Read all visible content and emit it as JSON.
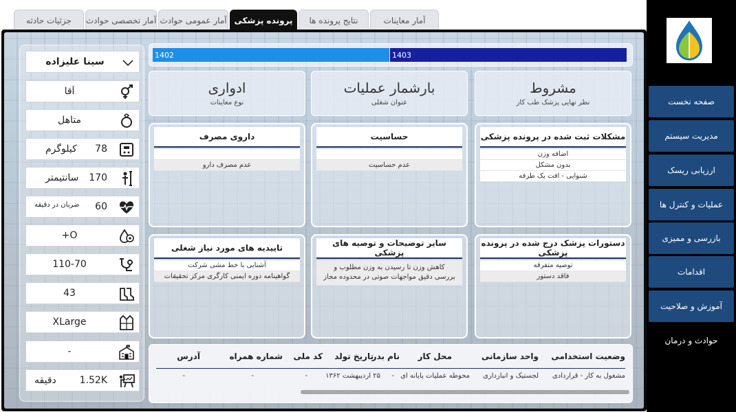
{
  "tabs": [
    {
      "label": "جزئیات حادثه",
      "active": false
    },
    {
      "label": "آمار تخصصی حوادث",
      "active": false
    },
    {
      "label": "آمار عمومی حوادث",
      "active": false
    },
    {
      "label": "پرونده پزشکی",
      "active": true
    },
    {
      "label": "نتایج پرونده ها",
      "active": false
    },
    {
      "label": "آمار معاینات",
      "active": false
    }
  ],
  "sidebar": {
    "logo_icon": "drop-leaf-logo-icon",
    "items": [
      {
        "label": "صفحه نخست"
      },
      {
        "label": "مدیریت سیستم"
      },
      {
        "label": "ارزیابی ریسک"
      },
      {
        "label": "عملیات و کنترل ها"
      },
      {
        "label": "بازرسی و ممیزی"
      },
      {
        "label": "اقدامات"
      },
      {
        "label": "آموزش و صلاحیت"
      },
      {
        "label": "حوادث و درمان"
      }
    ]
  },
  "profile": {
    "name": "سینا علیزاده",
    "gender": "آقا",
    "marital": "متاهل",
    "weight": {
      "value": "78",
      "unit": "کیلوگرم"
    },
    "height": {
      "value": "170",
      "unit": "سانتیمتر"
    },
    "heart_rate": {
      "value": "60",
      "unit": "ضربان در دقیقه"
    },
    "blood_type": "O+",
    "blood_pressure": "110-70",
    "shoe_size": "43",
    "clothing_size": "XLarge",
    "education": "-",
    "presentation": {
      "value": "1.52K",
      "unit": "دقیقه"
    }
  },
  "year_bar": {
    "segments": [
      {
        "label": "1402",
        "share": 0.495,
        "color": "#1e8fe8"
      },
      {
        "label": "1403",
        "share": 0.505,
        "color": "#16209e"
      }
    ]
  },
  "kpis": [
    {
      "value": "مشروط",
      "label": "نظر نهایی پزشک طب کار"
    },
    {
      "value": "بارشمار عملیات",
      "label": "عنوان شغلی"
    },
    {
      "value": "ادواری",
      "label": "نوع معاینات"
    }
  ],
  "cards": {
    "problems": {
      "title": "مشکلات ثبت شده در پرونده پزشکی",
      "rows": [
        "اضافه وزن",
        "بدون مشکل",
        "شنوایی - افت یک طرفه"
      ]
    },
    "sensitivity": {
      "title": "حساسیت",
      "rows": [
        "",
        "عدم حساسیت"
      ]
    },
    "medication": {
      "title": "داروی مصرف",
      "rows": [
        "",
        "عدم مصرف دارو"
      ]
    },
    "instructions": {
      "title": "دستورات پزشک درج شده در پرونده پزشکی",
      "rows": [
        "توصیه متفرقه",
        "فاقد دستور"
      ]
    },
    "recommendations": {
      "title": "سایر توضیحات و توصیه های پزشکی",
      "text": "کاهش وزن تا رسیدن به وزن مطلوب و بررسی دقیق مواجهات صوتی در محدوده مجاز"
    },
    "approvals": {
      "title": "تاییدیه های مورد نیاز شغلی",
      "rows": [
        "آشنایی با خط مشی شرکت",
        "گواهینامه دوره ایمنی کارگری مرکز تحقیقات"
      ]
    }
  },
  "bottom_table": {
    "columns": [
      "وضعیت استخدامی",
      "واحد سازمانی",
      "محل کار",
      "نام بدر",
      "تاریخ تولد",
      "کد ملی",
      "شماره همراه",
      "آدرس"
    ],
    "row": [
      "مشغول به کار - قراردادی",
      "لجستیک و انبارداری",
      "محوطه عملیات پایانه ای",
      "-",
      "۲۵ اردیبهشت ۱۳۶۲",
      "-",
      "-",
      "-"
    ]
  }
}
